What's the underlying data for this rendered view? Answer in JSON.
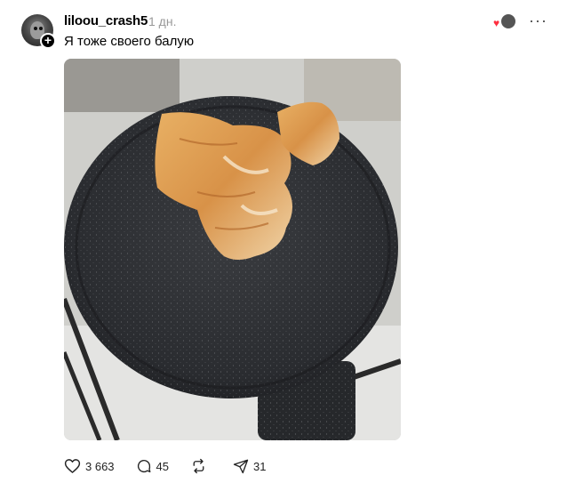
{
  "post": {
    "username": "liloou_crash5",
    "timestamp": "1 дн.",
    "caption": "Я тоже своего балую",
    "follow_symbol": "+",
    "more_symbol": "···",
    "reaction_symbol": "♥"
  },
  "actions": {
    "likes": "3 663",
    "comments": "45",
    "reposts": "",
    "shares": "31"
  },
  "icons": [
    "heart-icon",
    "comment-icon",
    "repost-icon",
    "share-icon",
    "more-icon",
    "plus-icon"
  ],
  "colors": {
    "heart": "#ff3040",
    "muted": "#999999"
  }
}
